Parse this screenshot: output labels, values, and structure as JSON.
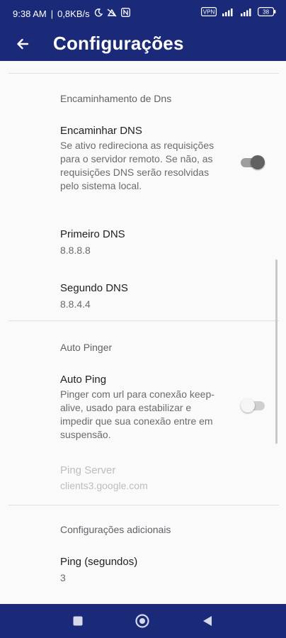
{
  "status_bar": {
    "time": "9:38 AM",
    "speed": "0,8KB/s",
    "icons": [
      "moon-icon",
      "no-signal-icon",
      "n-badge-icon",
      "vpn-icon",
      "signal-icon",
      "signal-icon",
      "battery-icon"
    ],
    "vpn_label": "VPN",
    "battery": "38"
  },
  "toolbar": {
    "back_icon": "arrow-back-icon",
    "title": "Configurações"
  },
  "sections": {
    "dns": {
      "category": "Encaminhamento de Dns",
      "forward_title": "Encaminhar DNS",
      "forward_summary": "Se ativo redireciona as requisições para o servidor remoto. Se não, as requisições DNS serão resolvidas pelo sistema local.",
      "forward_enabled": true,
      "primary_title": "Primeiro DNS",
      "primary_value": "8.8.8.8",
      "secondary_title": "Segundo DNS",
      "secondary_value": "8.8.4.4"
    },
    "pinger": {
      "category": "Auto Pinger",
      "autoping_title": "Auto Ping",
      "autoping_summary": "Pinger com url para conexão keep-alive, usado para estabilizar e impedir que sua conexão entre em suspensão.",
      "autoping_enabled": false,
      "server_title": "Ping Server",
      "server_value": "clients3.google.com"
    },
    "extra": {
      "category": "Configurações adicionais",
      "ping_title": "Ping (segundos)",
      "ping_value": "3"
    }
  },
  "nav_bar": {
    "icons": [
      "recents-square-icon",
      "home-circle-icon",
      "back-triangle-icon"
    ]
  }
}
